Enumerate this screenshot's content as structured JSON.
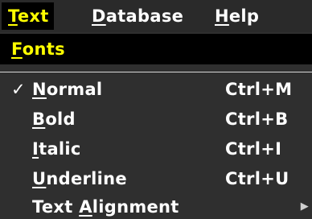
{
  "menubar": {
    "items": [
      {
        "label_first": "T",
        "label_rest": "ext",
        "active": true
      },
      {
        "label_first": "D",
        "label_rest": "atabase",
        "active": false
      },
      {
        "label_first": "H",
        "label_rest": "elp",
        "active": false
      }
    ]
  },
  "submenu": {
    "fonts_first": "F",
    "fonts_rest": "onts"
  },
  "menu": {
    "items": [
      {
        "check": "✓",
        "label_first": "N",
        "label_rest": "ormal",
        "shortcut": "Ctrl+M"
      },
      {
        "check": "",
        "label_first": "B",
        "label_rest": "old",
        "shortcut": "Ctrl+B"
      },
      {
        "check": "",
        "label_first": "I",
        "label_rest": "talic",
        "shortcut": "Ctrl+I"
      },
      {
        "check": "",
        "label_first": "U",
        "label_rest": "nderline",
        "shortcut": "Ctrl+U"
      },
      {
        "check": "",
        "label_before": "Text ",
        "label_first": "A",
        "label_rest": "lignment",
        "shortcut": ""
      }
    ],
    "has_submenu_icon": "chevron-right-icon"
  },
  "colors": {
    "active_text": "#ffff00",
    "active_bg": "#000000",
    "menu_bg": "#2f2f2f",
    "text": "#ffffff"
  }
}
